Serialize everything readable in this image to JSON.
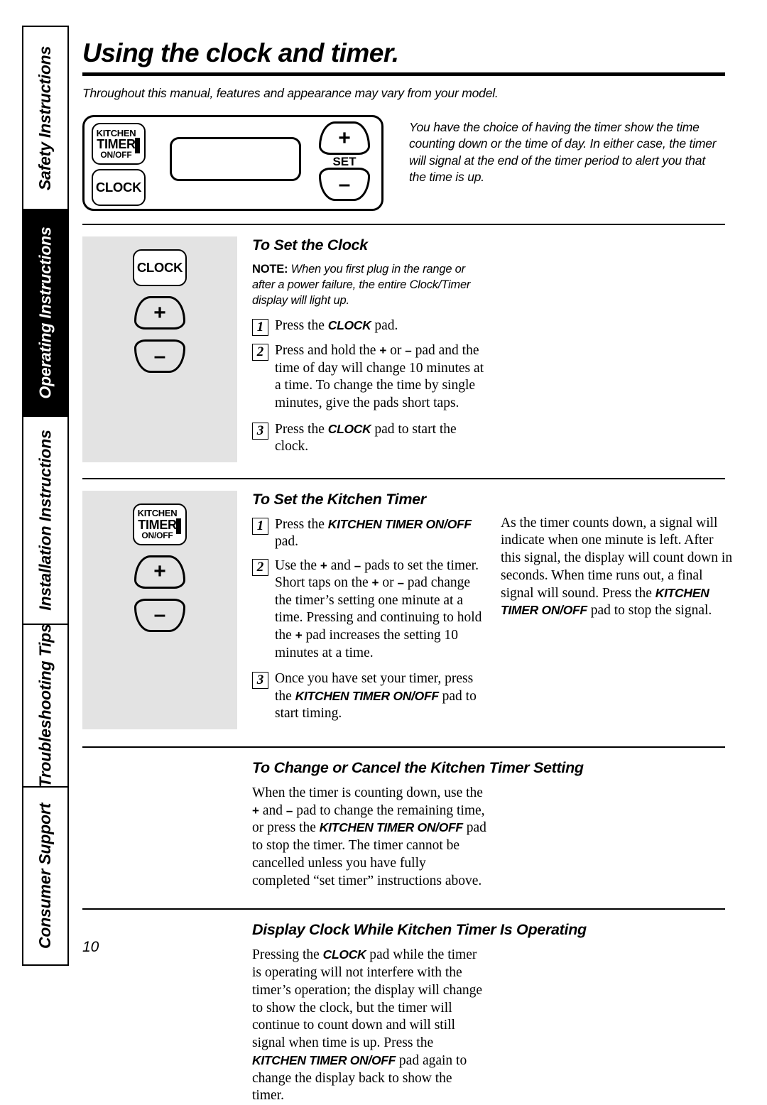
{
  "sidebar": {
    "tabs": [
      {
        "label": "Safety Instructions",
        "active": false
      },
      {
        "label": "Operating Instructions",
        "active": true
      },
      {
        "label": "Installation Instructions",
        "active": false
      },
      {
        "label": "Troubleshooting Tips",
        "active": false
      },
      {
        "label": "Consumer Support",
        "active": false
      }
    ]
  },
  "header": {
    "title": "Using the clock and timer.",
    "intro": "Throughout this manual, features and appearance may vary from your model."
  },
  "control_panel": {
    "kitchen_timer_pad": {
      "line1": "KITCHEN",
      "line2": "TIMER",
      "line3": "ON/OFF"
    },
    "clock_pad": "CLOCK",
    "plus_pad": "+",
    "minus_pad": "–",
    "set_label": "SET",
    "note": "You have the choice of having the timer show the time counting down or the time of day. In either case, the timer will signal at the end of the timer period to alert you that the time is up."
  },
  "set_clock": {
    "heading": "To Set the Clock",
    "note_label": "NOTE:",
    "note_text": " When you first plug in the range or after a power failure, the entire Clock/Timer display will light up.",
    "steps": [
      {
        "num": "1",
        "pre": "Press the ",
        "pad": "CLOCK",
        "post": " pad."
      },
      {
        "num": "2",
        "pre": "Press and hold the ",
        "pad": "",
        "post": ""
      },
      {
        "num": "3",
        "pre": "Press the ",
        "pad": "CLOCK",
        "post": " pad to start the clock."
      }
    ],
    "step2_text_a": "Press and hold the ",
    "step2_sym1": "+",
    "step2_text_b": " or ",
    "step2_sym2": "–",
    "step2_text_c": " pad and the time of day will change 10 minutes at a time. To change the time by single minutes, give the pads short taps."
  },
  "set_timer": {
    "heading": "To Set the Kitchen Timer",
    "step1_pre": "Press the ",
    "step1_pad": "KITCHEN TIMER ON/OFF",
    "step1_post": " pad.",
    "step2_a": "Use the ",
    "step2_sym1": "+",
    "step2_b": " and ",
    "step2_sym2": "–",
    "step2_c": " pads to set the timer. Short taps on the ",
    "step2_sym3": "+",
    "step2_d": " or ",
    "step2_sym4": "–",
    "step2_e": " pad change the timer’s setting one minute at a time. Pressing and continuing to hold the ",
    "step2_sym5": "+",
    "step2_f": " pad increases the setting 10 minutes at a time.",
    "step3_a": "Once you have set your timer, press the ",
    "step3_pad": "KITCHEN TIMER ON/OFF",
    "step3_b": " pad to start timing.",
    "right_a": "As the timer counts down, a signal will indicate when one minute is left. After this signal, the display will count down in seconds. When time runs out, a final signal will sound. Press the ",
    "right_pad": "KITCHEN TIMER ON/OFF",
    "right_b": " pad to stop the signal."
  },
  "change_cancel": {
    "heading": "To Change or Cancel the Kitchen Timer Setting",
    "a": "When the timer is counting down, use the ",
    "sym1": "+",
    "b": " and ",
    "sym2": "–",
    "c": " pad to change the remaining time, or press the ",
    "pad": "KITCHEN TIMER ON/OFF",
    "d": " pad to stop the timer. The timer cannot be cancelled unless you have fully completed “set timer” instructions above."
  },
  "display_clock": {
    "heading": "Display Clock While Kitchen Timer Is Operating",
    "a": "Pressing the ",
    "pad1": "CLOCK",
    "b": " pad while the timer is operating will not interfere with the timer’s operation; the display will change to show the clock, but the timer will continue to count down and will still signal when time is up. Press the ",
    "pad2": "KITCHEN TIMER ON/OFF",
    "c": " pad again to change the display back to show the timer."
  },
  "footer": {
    "page_number": "10"
  }
}
